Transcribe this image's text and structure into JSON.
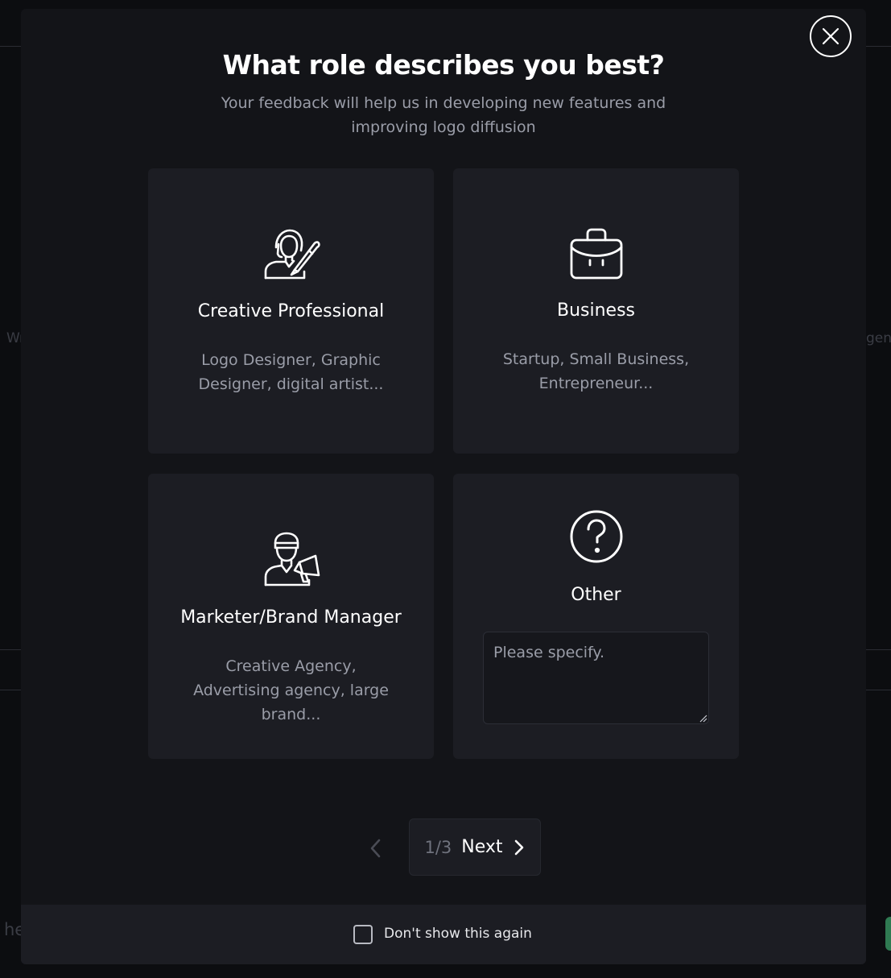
{
  "background": {
    "left_fragment": "Wr",
    "right_fragment": "gene",
    "bottom_fragment": "he"
  },
  "modal": {
    "title": "What role describes you best?",
    "subtitle": "Your feedback will help us in developing new features and improving logo diffusion",
    "close_icon": "close-icon",
    "roles": [
      {
        "title": "Creative Professional",
        "description": "Logo Designer, Graphic Designer, digital artist...",
        "icon": "artist-brush-icon"
      },
      {
        "title": "Business",
        "description": "Startup, Small Business, Entrepreneur...",
        "icon": "briefcase-icon"
      },
      {
        "title": "Marketer/Brand Manager",
        "description": "Creative Agency, Advertising agency, large brand...",
        "icon": "megaphone-person-icon"
      },
      {
        "title": "Other",
        "placeholder": "Please specify.",
        "icon": "question-circle-icon"
      }
    ],
    "pagination": {
      "page_indicator": "1/3",
      "next_label": "Next"
    },
    "footer": {
      "checkbox_label": "Don't show this again",
      "checked": false
    }
  },
  "colors": {
    "page_bg": "#0c0d10",
    "modal_bg": "#131418",
    "card_bg": "#1c1d23",
    "muted_text": "#9a9da8"
  }
}
